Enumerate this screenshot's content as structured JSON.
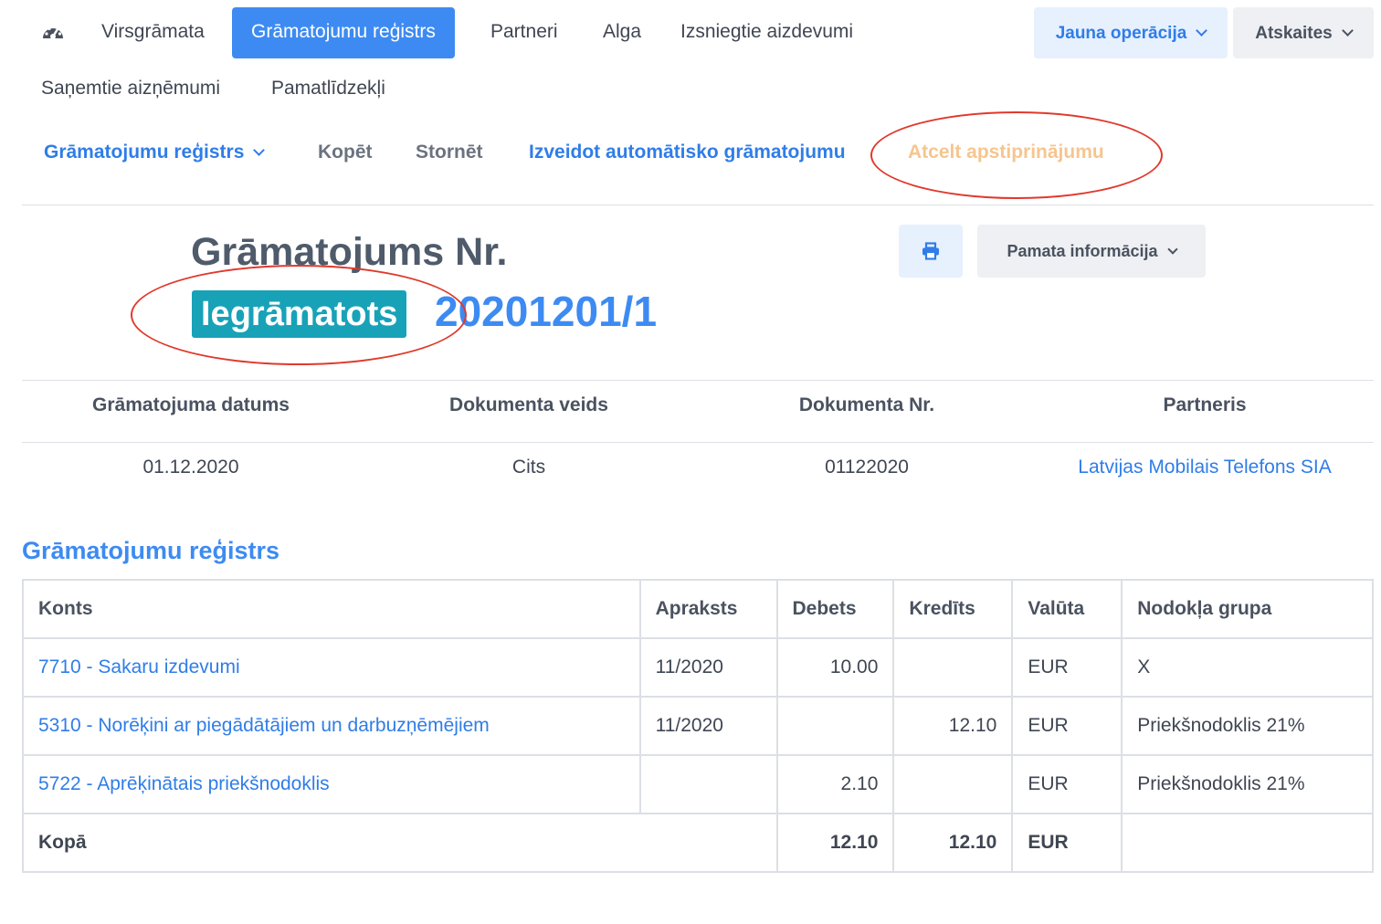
{
  "nav": {
    "items": [
      "Virsgrāmata",
      "Grāmatojumu reģistrs",
      "Partneri",
      "Alga",
      "Izsniegtie aizdevumi",
      "Saņemtie aizņēmumi",
      "Pamatlīdzekļi"
    ],
    "active": "Grāmatojumu reģistrs",
    "new_operation": "Jauna operācija",
    "reports": "Atskaites"
  },
  "actions": {
    "register": "Grāmatojumu reģistrs",
    "copy": "Kopēt",
    "reverse": "Stornēt",
    "auto_create": "Izveidot automātisko grāmatojumu",
    "cancel_approval": "Atcelt apstiprinājumu"
  },
  "entry": {
    "title": "Grāmatojums Nr.",
    "status": "Iegrāmatots",
    "number": "20201201/1",
    "basic_info": "Pamata informācija"
  },
  "info": {
    "headers": [
      "Grāmatojuma datums",
      "Dokumenta veids",
      "Dokumenta Nr.",
      "Partneris"
    ],
    "values": [
      "01.12.2020",
      "Cits",
      "01122020",
      "Latvijas Mobilais Telefons SIA"
    ]
  },
  "register": {
    "title": "Grāmatojumu reģistrs",
    "columns": [
      "Konts",
      "Apraksts",
      "Debets",
      "Kredīts",
      "Valūta",
      "Nodokļa grupa"
    ],
    "rows": [
      {
        "account": "7710 - Sakaru izdevumi",
        "description": "11/2020",
        "debit": "10.00",
        "credit": "",
        "currency": "EUR",
        "tax_group": "X"
      },
      {
        "account": "5310 - Norēķini ar piegādātājiem un darbuzņēmējiem",
        "description": "11/2020",
        "debit": "",
        "credit": "12.10",
        "currency": "EUR",
        "tax_group": "Priekšnodoklis 21%"
      },
      {
        "account": "5722 - Aprēķinātais priekšnodoklis",
        "description": "",
        "debit": "2.10",
        "credit": "",
        "currency": "EUR",
        "tax_group": "Priekšnodoklis 21%"
      }
    ],
    "total": {
      "label": "Kopā",
      "debit": "12.10",
      "credit": "12.10",
      "currency": "EUR"
    }
  },
  "colors": {
    "accent": "#3d8bf2",
    "status": "#17a2b8",
    "disabled_link": "#f6c58e",
    "annotation": "#e0392c"
  },
  "icons": {
    "dashboard": "dashboard-icon",
    "print": "print-icon"
  }
}
